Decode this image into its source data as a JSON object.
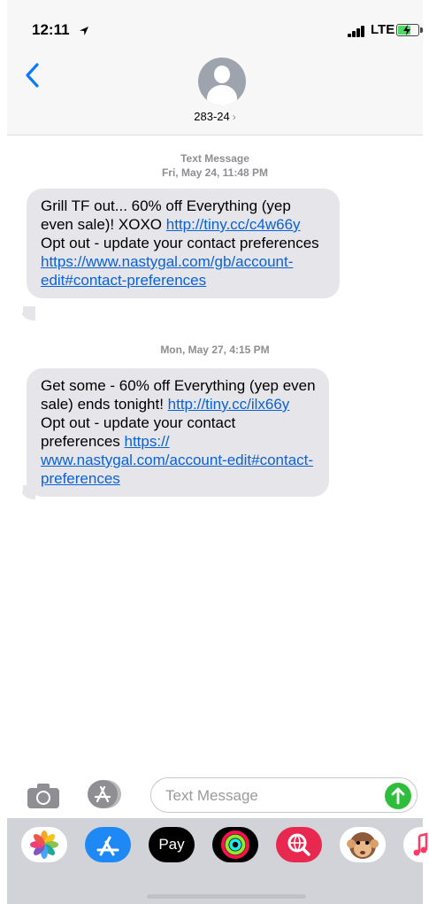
{
  "status": {
    "time": "12:11",
    "network": "LTE"
  },
  "contact": {
    "name": "283-24",
    "chevron": "›"
  },
  "messages": [
    {
      "meta_type": "Text Message",
      "meta_time": "Fri, May 24, 11:48 PM",
      "parts": [
        {
          "t": "text",
          "v": "Grill TF out... 60% off Everything (yep even sale)! XOXO "
        },
        {
          "t": "link",
          "v": "http://tiny.cc/​c4w66y"
        },
        {
          "t": "text",
          "v": " Opt out - update your contact preferences "
        },
        {
          "t": "link",
          "v": "https://​www.nastygal.com/gb/account-​edit#contact-preferences"
        }
      ]
    },
    {
      "meta_time": "Mon, May 27, 4:15 PM",
      "parts": [
        {
          "t": "text",
          "v": "Get some - 60% off Everything (yep even sale) ends tonight! "
        },
        {
          "t": "link",
          "v": "http://​tiny.cc/ilx66y"
        },
        {
          "t": "text",
          "v": " Opt out - update your contact preferences "
        },
        {
          "t": "link",
          "v": "https://​www.nastygal.com/account-​edit#contact-preferences"
        }
      ]
    }
  ],
  "input": {
    "placeholder": "Text Message"
  },
  "tray": {
    "applepay_label": "Pay",
    "applepay_glyph": ""
  },
  "colors": {
    "link": "#0a62d8",
    "bubble": "#e5e5ea",
    "send": "#2fbe3c",
    "accent": "#0a7aff"
  },
  "icons": [
    "location-arrow-icon",
    "signal-icon",
    "battery-icon",
    "back-chevron-icon",
    "avatar-icon",
    "camera-icon",
    "app-store-icon",
    "send-arrow-icon",
    "photos-icon",
    "apple-pay-icon",
    "activity-icon",
    "web-search-icon",
    "memoji-icon",
    "music-icon"
  ]
}
